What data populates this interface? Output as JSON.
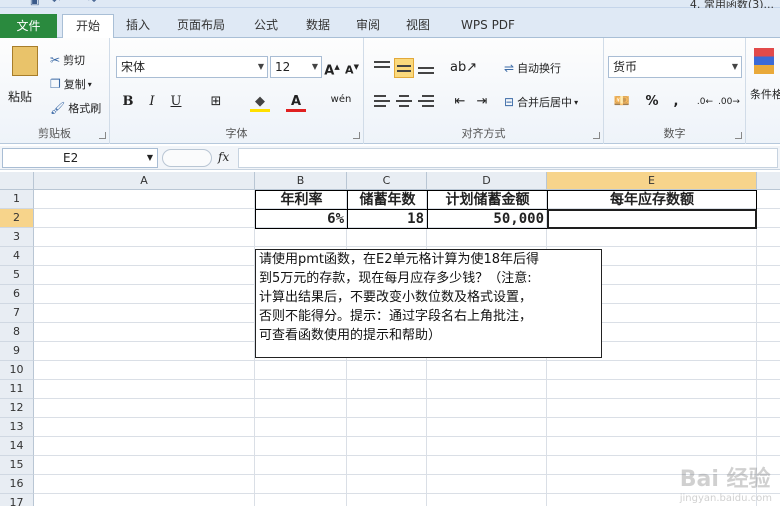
{
  "doc_title": "4. 常用函数(3)...",
  "tabs": {
    "file": "文件",
    "items": [
      "开始",
      "插入",
      "页面布局",
      "公式",
      "数据",
      "审阅",
      "视图",
      "WPS PDF"
    ]
  },
  "ribbon": {
    "clipboard": {
      "label": "剪贴板",
      "paste": "粘贴",
      "cut": "剪切",
      "copy": "复制",
      "format_painter": "格式刷"
    },
    "font": {
      "label": "字体",
      "font_name": "宋体",
      "font_size": "12"
    },
    "alignment": {
      "label": "对齐方式",
      "wrap_text": "自动换行",
      "merge_center": "合并后居中"
    },
    "number": {
      "label": "数字",
      "format": "货币"
    },
    "styles": {
      "conditional": "条件格"
    }
  },
  "formula_bar": {
    "name_box": "E2",
    "fx": "fx",
    "value": ""
  },
  "grid": {
    "columns": [
      "A",
      "B",
      "C",
      "D",
      "E"
    ],
    "selected_column": "E",
    "rows": [
      "1",
      "2",
      "3",
      "4",
      "5",
      "6",
      "7",
      "8",
      "9",
      "10",
      "11",
      "12",
      "13",
      "14",
      "15",
      "16",
      "17"
    ],
    "selected_row": "2",
    "headers": {
      "b1": "年利率",
      "c1": "储蓄年数",
      "d1": "计划储蓄金额",
      "e1": "每年应存数额"
    },
    "values": {
      "b2": "6%",
      "c2": "18",
      "d2": "50,000",
      "e2": ""
    },
    "note_lines": [
      "请使用pmt函数，在E2单元格计算为使18年后得",
      "到5万元的存款，现在每月应存多少钱？（注意:",
      "计算出结果后，不要改变小数位数及格式设置，",
      "否则不能得分。提示：通过字段名右上角批注，",
      "可查看函数使用的提示和帮助）"
    ]
  },
  "watermark": {
    "text": "Bai 经验",
    "sub": "jingyan.baidu.com"
  }
}
